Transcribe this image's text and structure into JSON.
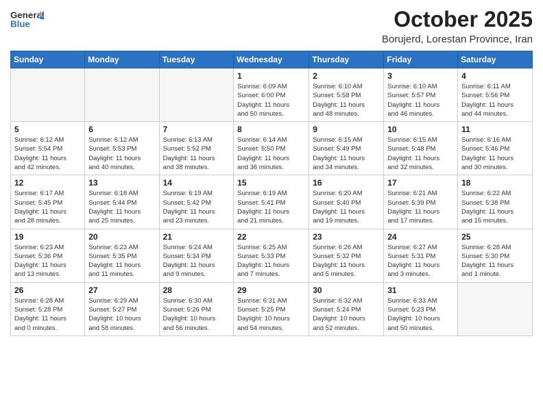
{
  "header": {
    "logo_general": "General",
    "logo_blue": "Blue",
    "month": "October 2025",
    "location": "Borujerd, Lorestan Province, Iran"
  },
  "weekdays": [
    "Sunday",
    "Monday",
    "Tuesday",
    "Wednesday",
    "Thursday",
    "Friday",
    "Saturday"
  ],
  "weeks": [
    [
      {
        "day": "",
        "info": ""
      },
      {
        "day": "",
        "info": ""
      },
      {
        "day": "",
        "info": ""
      },
      {
        "day": "1",
        "info": "Sunrise: 6:09 AM\nSunset: 6:00 PM\nDaylight: 11 hours\nand 50 minutes."
      },
      {
        "day": "2",
        "info": "Sunrise: 6:10 AM\nSunset: 5:58 PM\nDaylight: 11 hours\nand 48 minutes."
      },
      {
        "day": "3",
        "info": "Sunrise: 6:10 AM\nSunset: 5:57 PM\nDaylight: 11 hours\nand 46 minutes."
      },
      {
        "day": "4",
        "info": "Sunrise: 6:11 AM\nSunset: 5:56 PM\nDaylight: 11 hours\nand 44 minutes."
      }
    ],
    [
      {
        "day": "5",
        "info": "Sunrise: 6:12 AM\nSunset: 5:54 PM\nDaylight: 11 hours\nand 42 minutes."
      },
      {
        "day": "6",
        "info": "Sunrise: 6:12 AM\nSunset: 5:53 PM\nDaylight: 11 hours\nand 40 minutes."
      },
      {
        "day": "7",
        "info": "Sunrise: 6:13 AM\nSunset: 5:52 PM\nDaylight: 11 hours\nand 38 minutes."
      },
      {
        "day": "8",
        "info": "Sunrise: 6:14 AM\nSunset: 5:50 PM\nDaylight: 11 hours\nand 36 minutes."
      },
      {
        "day": "9",
        "info": "Sunrise: 6:15 AM\nSunset: 5:49 PM\nDaylight: 11 hours\nand 34 minutes."
      },
      {
        "day": "10",
        "info": "Sunrise: 6:15 AM\nSunset: 5:48 PM\nDaylight: 11 hours\nand 32 minutes."
      },
      {
        "day": "11",
        "info": "Sunrise: 6:16 AM\nSunset: 5:46 PM\nDaylight: 11 hours\nand 30 minutes."
      }
    ],
    [
      {
        "day": "12",
        "info": "Sunrise: 6:17 AM\nSunset: 5:45 PM\nDaylight: 11 hours\nand 28 minutes."
      },
      {
        "day": "13",
        "info": "Sunrise: 6:18 AM\nSunset: 5:44 PM\nDaylight: 11 hours\nand 25 minutes."
      },
      {
        "day": "14",
        "info": "Sunrise: 6:19 AM\nSunset: 5:42 PM\nDaylight: 11 hours\nand 23 minutes."
      },
      {
        "day": "15",
        "info": "Sunrise: 6:19 AM\nSunset: 5:41 PM\nDaylight: 11 hours\nand 21 minutes."
      },
      {
        "day": "16",
        "info": "Sunrise: 6:20 AM\nSunset: 5:40 PM\nDaylight: 11 hours\nand 19 minutes."
      },
      {
        "day": "17",
        "info": "Sunrise: 6:21 AM\nSunset: 5:39 PM\nDaylight: 11 hours\nand 17 minutes."
      },
      {
        "day": "18",
        "info": "Sunrise: 6:22 AM\nSunset: 5:38 PM\nDaylight: 11 hours\nand 15 minutes."
      }
    ],
    [
      {
        "day": "19",
        "info": "Sunrise: 6:23 AM\nSunset: 5:36 PM\nDaylight: 11 hours\nand 13 minutes."
      },
      {
        "day": "20",
        "info": "Sunrise: 6:23 AM\nSunset: 5:35 PM\nDaylight: 11 hours\nand 11 minutes."
      },
      {
        "day": "21",
        "info": "Sunrise: 6:24 AM\nSunset: 5:34 PM\nDaylight: 11 hours\nand 9 minutes."
      },
      {
        "day": "22",
        "info": "Sunrise: 6:25 AM\nSunset: 5:33 PM\nDaylight: 11 hours\nand 7 minutes."
      },
      {
        "day": "23",
        "info": "Sunrise: 6:26 AM\nSunset: 5:32 PM\nDaylight: 11 hours\nand 5 minutes."
      },
      {
        "day": "24",
        "info": "Sunrise: 6:27 AM\nSunset: 5:31 PM\nDaylight: 11 hours\nand 3 minutes."
      },
      {
        "day": "25",
        "info": "Sunrise: 6:28 AM\nSunset: 5:30 PM\nDaylight: 11 hours\nand 1 minute."
      }
    ],
    [
      {
        "day": "26",
        "info": "Sunrise: 6:28 AM\nSunset: 5:28 PM\nDaylight: 11 hours\nand 0 minutes."
      },
      {
        "day": "27",
        "info": "Sunrise: 6:29 AM\nSunset: 5:27 PM\nDaylight: 10 hours\nand 58 minutes."
      },
      {
        "day": "28",
        "info": "Sunrise: 6:30 AM\nSunset: 5:26 PM\nDaylight: 10 hours\nand 56 minutes."
      },
      {
        "day": "29",
        "info": "Sunrise: 6:31 AM\nSunset: 5:25 PM\nDaylight: 10 hours\nand 54 minutes."
      },
      {
        "day": "30",
        "info": "Sunrise: 6:32 AM\nSunset: 5:24 PM\nDaylight: 10 hours\nand 52 minutes."
      },
      {
        "day": "31",
        "info": "Sunrise: 6:33 AM\nSunset: 5:23 PM\nDaylight: 10 hours\nand 50 minutes."
      },
      {
        "day": "",
        "info": ""
      }
    ]
  ]
}
